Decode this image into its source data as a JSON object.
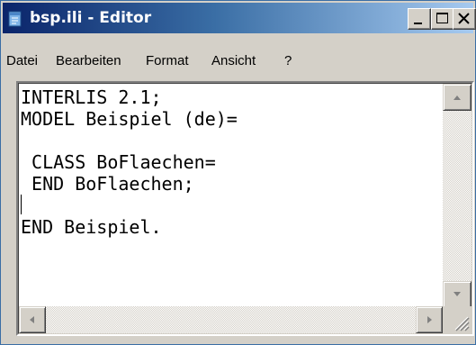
{
  "window": {
    "title": "bsp.ili - Editor",
    "icon": "notepad-icon"
  },
  "title_buttons": {
    "minimize": "minimize-icon",
    "maximize": "maximize-icon",
    "close": "close-icon"
  },
  "menu": {
    "items": [
      {
        "label": "Datei"
      },
      {
        "label": "Bearbeiten"
      },
      {
        "label": "Format"
      },
      {
        "label": "Ansicht"
      },
      {
        "label": "?"
      }
    ]
  },
  "editor": {
    "lines": [
      "INTERLIS 2.1;",
      "MODEL Beispiel (de)=",
      "",
      " CLASS BoFlaechen=",
      " END BoFlaechen;",
      "",
      "END Beispiel."
    ],
    "caret_line": 5
  },
  "colors": {
    "title_gradient_start": "#0a246a",
    "title_gradient_end": "#a6caf0",
    "face": "#d4d0c8"
  }
}
